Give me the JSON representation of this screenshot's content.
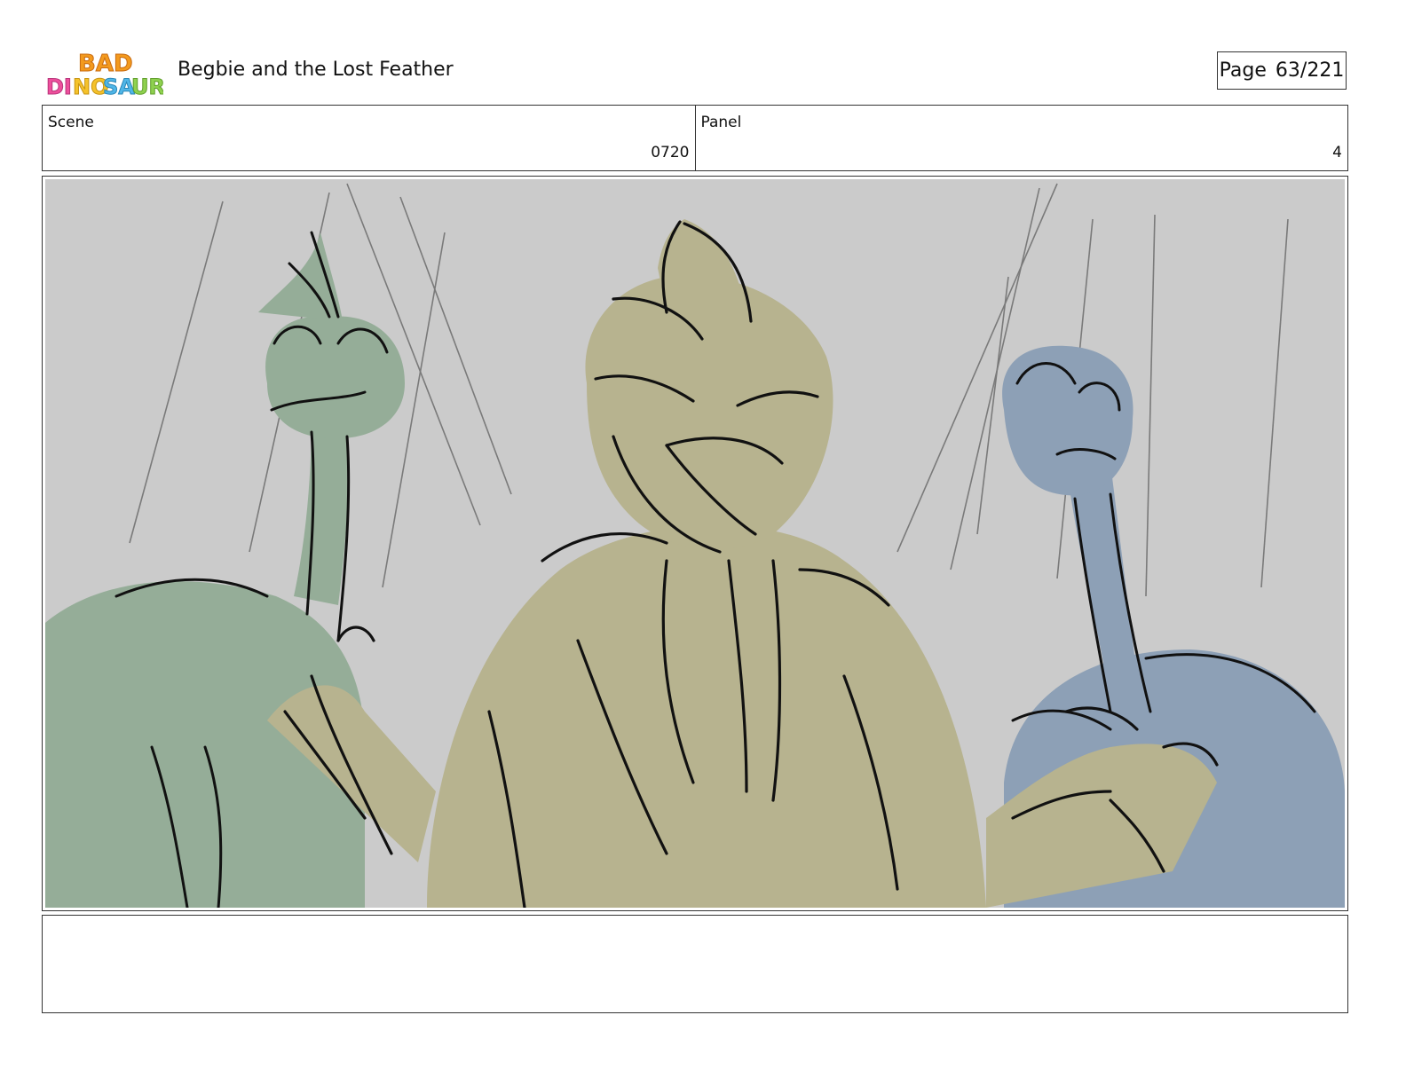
{
  "header": {
    "logo_text": "BAD DINOSAURS",
    "title": "Begbie and the Lost Feather",
    "page_label": "Page",
    "page_value": "63/221"
  },
  "info": {
    "scene_label": "Scene",
    "scene_value": "0720",
    "panel_label": "Panel",
    "panel_value": "4"
  },
  "notes": {
    "text": ""
  },
  "colors": {
    "background_gray": "#cbcbcb",
    "green_dino": "#95ad98",
    "tan_dino": "#b7b38f",
    "blue_dino": "#8da0b6",
    "ink": "#111111"
  }
}
